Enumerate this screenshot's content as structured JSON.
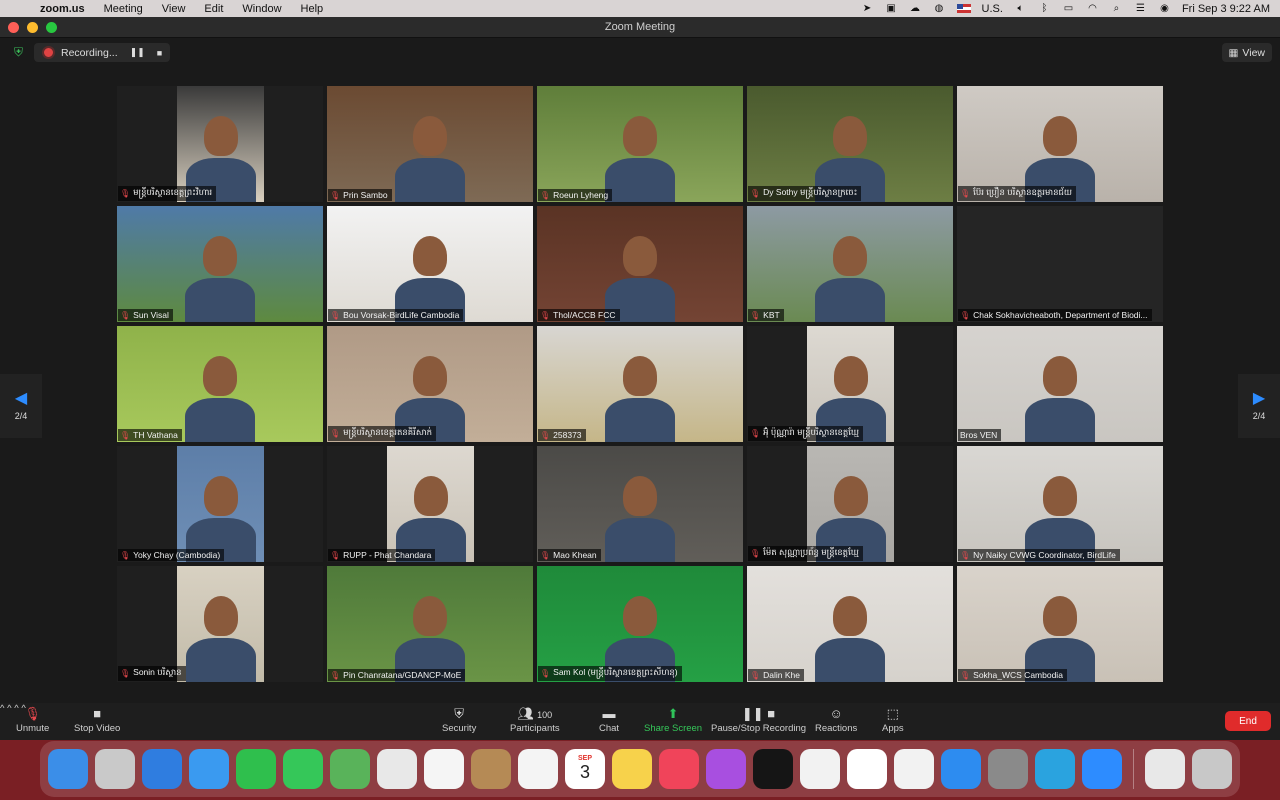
{
  "menubar": {
    "app": "zoom.us",
    "menus": [
      "Meeting",
      "View",
      "Edit",
      "Window",
      "Help"
    ],
    "input_source": "U.S.",
    "datetime": "Fri Sep 3  9:22 AM"
  },
  "window": {
    "title": "Zoom Meeting",
    "recording_label": "Recording...",
    "view_label": "View"
  },
  "pager": {
    "left": "2/4",
    "right": "2/4"
  },
  "participants": [
    {
      "name": "មន្ត្រីបរិស្ថានខេត្តព្រះវិហារ",
      "bg": "#3a3a3a",
      "scene": "#d9d0c0",
      "muted": true
    },
    {
      "name": "Prin Sambo",
      "bg": "#6b4a32",
      "scene": "#7e6a55",
      "muted": true
    },
    {
      "name": "Roeun Lyheng",
      "bg": "#5f7e3a",
      "scene": "#8aa55a",
      "muted": true
    },
    {
      "name": "Dy Sothy មន្ត្រីបរិស្ថានក្រចេះ",
      "bg": "#4a5a2e",
      "scene": "#6d7e44",
      "muted": true
    },
    {
      "name": "ប៊ែរ ប្រឿន បរិស្ថានឧត្តរមានជ័យ",
      "bg": "#cfcac4",
      "scene": "#b9b2aa",
      "muted": true
    },
    {
      "name": "Sun Visal",
      "bg": "#4f7aa8",
      "scene": "#5e8a3f",
      "muted": true
    },
    {
      "name": "Bou Vorsak-BirdLife Cambodia",
      "bg": "#f2f2f2",
      "scene": "#dedad3",
      "muted": true
    },
    {
      "name": "Thol/ACCB FCC",
      "bg": "#5a3324",
      "scene": "#744434",
      "muted": true
    },
    {
      "name": "KBT",
      "bg": "#8d9aa3",
      "scene": "#6a8a52",
      "muted": true
    },
    {
      "name": "Chak Sokhavicheaboth, Department of Biodi...",
      "bg": "#252525",
      "scene": "#252525",
      "muted": true
    },
    {
      "name": "TH Vathana",
      "bg": "#8fb24a",
      "scene": "#a8c95c",
      "muted": true
    },
    {
      "name": "មន្ត្រីបរិស្ថានខេត្តរតនគិរីសាក់",
      "bg": "#b09a86",
      "scene": "#c2ae98",
      "muted": true
    },
    {
      "name": "258373",
      "bg": "#d8d6d2",
      "scene": "#c5b688",
      "muted": true
    },
    {
      "name": "អ៊ុំ ប៉ុណ្ណារ៉ា មន្ត្រីបរិស្ថានខេត្តឃ្មែ",
      "bg": "#ddd9d2",
      "scene": "#c7c2b9",
      "muted": true
    },
    {
      "name": "Bros VEN",
      "bg": "#d6d3cf",
      "scene": "#c9c6c1",
      "muted": false
    },
    {
      "name": "Yoky Chay (Cambodia)",
      "bg": "#5d7ea8",
      "scene": "#6f8fb6",
      "muted": true
    },
    {
      "name": "RUPP - Phat Chandara",
      "bg": "#ddd8d0",
      "scene": "#c9c2b6",
      "muted": true
    },
    {
      "name": "Mao Khean",
      "bg": "#4b4a47",
      "scene": "#615e59",
      "muted": true
    },
    {
      "name": "ម៉ែត សុណ្ណាប្រព័ន្ធ មន្ត្រីខេត្តឃ្មែ",
      "bg": "#b9b7b3",
      "scene": "#a9a7a3",
      "muted": true
    },
    {
      "name": "Ny Naiky CVWG Coordinator, BirdLife",
      "bg": "#d9d7d3",
      "scene": "#c7c4be",
      "muted": true
    },
    {
      "name": "Sonin បរិស្ថាន",
      "bg": "#d8d1c2",
      "scene": "#c2bba9",
      "muted": true
    },
    {
      "name": "Pin Chanratana/GDANCP-MoE",
      "bg": "#4f7a3a",
      "scene": "#6a9446",
      "muted": true
    },
    {
      "name": "Sam Kol (មន្ត្រីបរិស្ថានខេត្តព្រះសីហនុ)",
      "bg": "#1f8a3a",
      "scene": "#25a045",
      "muted": true
    },
    {
      "name": "Dalin Khe",
      "bg": "#e3e0dc",
      "scene": "#d6d2cc",
      "muted": true
    },
    {
      "name": "Sokha_WCS Cambodia",
      "bg": "#d9d3cb",
      "scene": "#c9c1b6",
      "muted": true
    }
  ],
  "toolbar": {
    "unmute": "Unmute",
    "stop_video": "Stop Video",
    "security": "Security",
    "participants": "Participants",
    "participants_count": "100",
    "chat": "Chat",
    "share_screen": "Share Screen",
    "pause_stop_recording": "Pause/Stop Recording",
    "reactions": "Reactions",
    "apps": "Apps",
    "end": "End"
  },
  "dock": {
    "calendar_month": "SEP",
    "calendar_day": "3",
    "apps": [
      {
        "name": "finder-icon",
        "color": "#3b8ee8"
      },
      {
        "name": "launchpad-icon",
        "color": "#c9c9c9"
      },
      {
        "name": "safari-icon",
        "color": "#2f7de0"
      },
      {
        "name": "mail-icon",
        "color": "#3a9af0"
      },
      {
        "name": "facetime-icon",
        "color": "#2fbf4d"
      },
      {
        "name": "messages-icon",
        "color": "#35c759"
      },
      {
        "name": "maps-icon",
        "color": "#59b35a"
      },
      {
        "name": "screenshot-icon",
        "color": "#e8e8e8"
      },
      {
        "name": "photos-icon",
        "color": "#f5f5f5"
      },
      {
        "name": "contacts-icon",
        "color": "#b58a55"
      },
      {
        "name": "reminders-icon",
        "color": "#f4f4f4"
      },
      {
        "name": "calendar-icon",
        "color": "#ffffff"
      },
      {
        "name": "notes-icon",
        "color": "#f7d24b"
      },
      {
        "name": "music-icon",
        "color": "#f0445a"
      },
      {
        "name": "podcasts-icon",
        "color": "#a84fe0"
      },
      {
        "name": "tv-icon",
        "color": "#151515"
      },
      {
        "name": "news-icon",
        "color": "#f2f2f2"
      },
      {
        "name": "numbers-icon",
        "color": "#ffffff"
      },
      {
        "name": "pages-icon",
        "color": "#f2f2f2"
      },
      {
        "name": "app-store-icon",
        "color": "#2d8cf0"
      },
      {
        "name": "system-preferences-icon",
        "color": "#8a8a8a"
      },
      {
        "name": "telegram-icon",
        "color": "#2aa3df"
      },
      {
        "name": "zoom-icon",
        "color": "#2d8cff"
      },
      {
        "name": "preview-icon",
        "color": "#e8e8e8"
      },
      {
        "name": "trash-icon",
        "color": "#c8c8c8"
      }
    ]
  }
}
